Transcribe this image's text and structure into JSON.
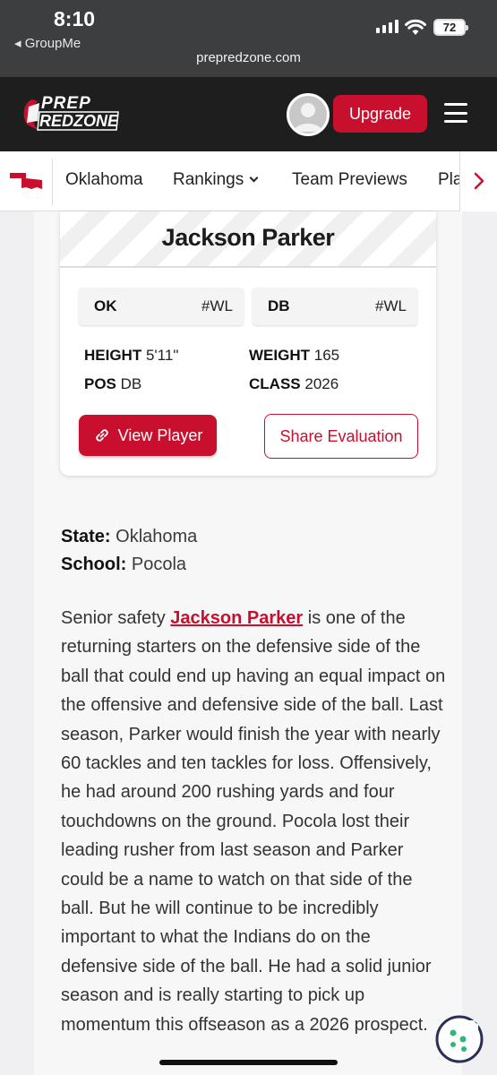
{
  "status_bar": {
    "time": "8:10",
    "back_app": "◂ GroupMe",
    "battery": "72"
  },
  "browser": {
    "url": "prepredzone.com"
  },
  "header": {
    "logo_top": "PREP",
    "logo_bottom": "REDZONE",
    "upgrade_label": "Upgrade",
    "brand_red": "#c8102e"
  },
  "subnav": {
    "items": [
      {
        "label": "Oklahoma"
      },
      {
        "label": "Rankings"
      },
      {
        "label": "Team Previews"
      },
      {
        "label": "Pla"
      }
    ],
    "icons": [
      "oklahoma-state-icon",
      "chevron-down-icon",
      "chevron-right-icon"
    ]
  },
  "player_card": {
    "name": "Jackson Parker",
    "chips": [
      {
        "label": "OK",
        "rank": "#WL"
      },
      {
        "label": "DB",
        "rank": "#WL"
      }
    ],
    "stats": {
      "height_label": "HEIGHT",
      "height_value": "5'11\"",
      "weight_label": "WEIGHT",
      "weight_value": "165",
      "pos_label": "POS",
      "pos_value": "DB",
      "class_label": "CLASS",
      "class_value": "2026"
    },
    "view_button": "View Player",
    "share_button": "Share Evaluation"
  },
  "meta": {
    "state_label": "State:",
    "state_value": "Oklahoma",
    "school_label": "School:",
    "school_value": "Pocola"
  },
  "article": {
    "intro": "Senior safety ",
    "player_link": "Jackson Parker",
    "body": " is one of the returning starters on the defensive side of the ball that could end up having an equal impact on the offensive and defensive side of the ball. Last season, Parker would finish the year with nearly 60 tackles and ten tackles for loss. Offensively, he had around 200 rushing yards and four touchdowns on the ground. Pocola lost their leading rusher from last season and Parker could be a name to watch on that side of the ball. But he will continue to be incredibly important to what the Indians do on the defensive side of the ball. He had a solid junior season and is really starting to pick up momentum this offseason as a 2026 prospect."
  }
}
